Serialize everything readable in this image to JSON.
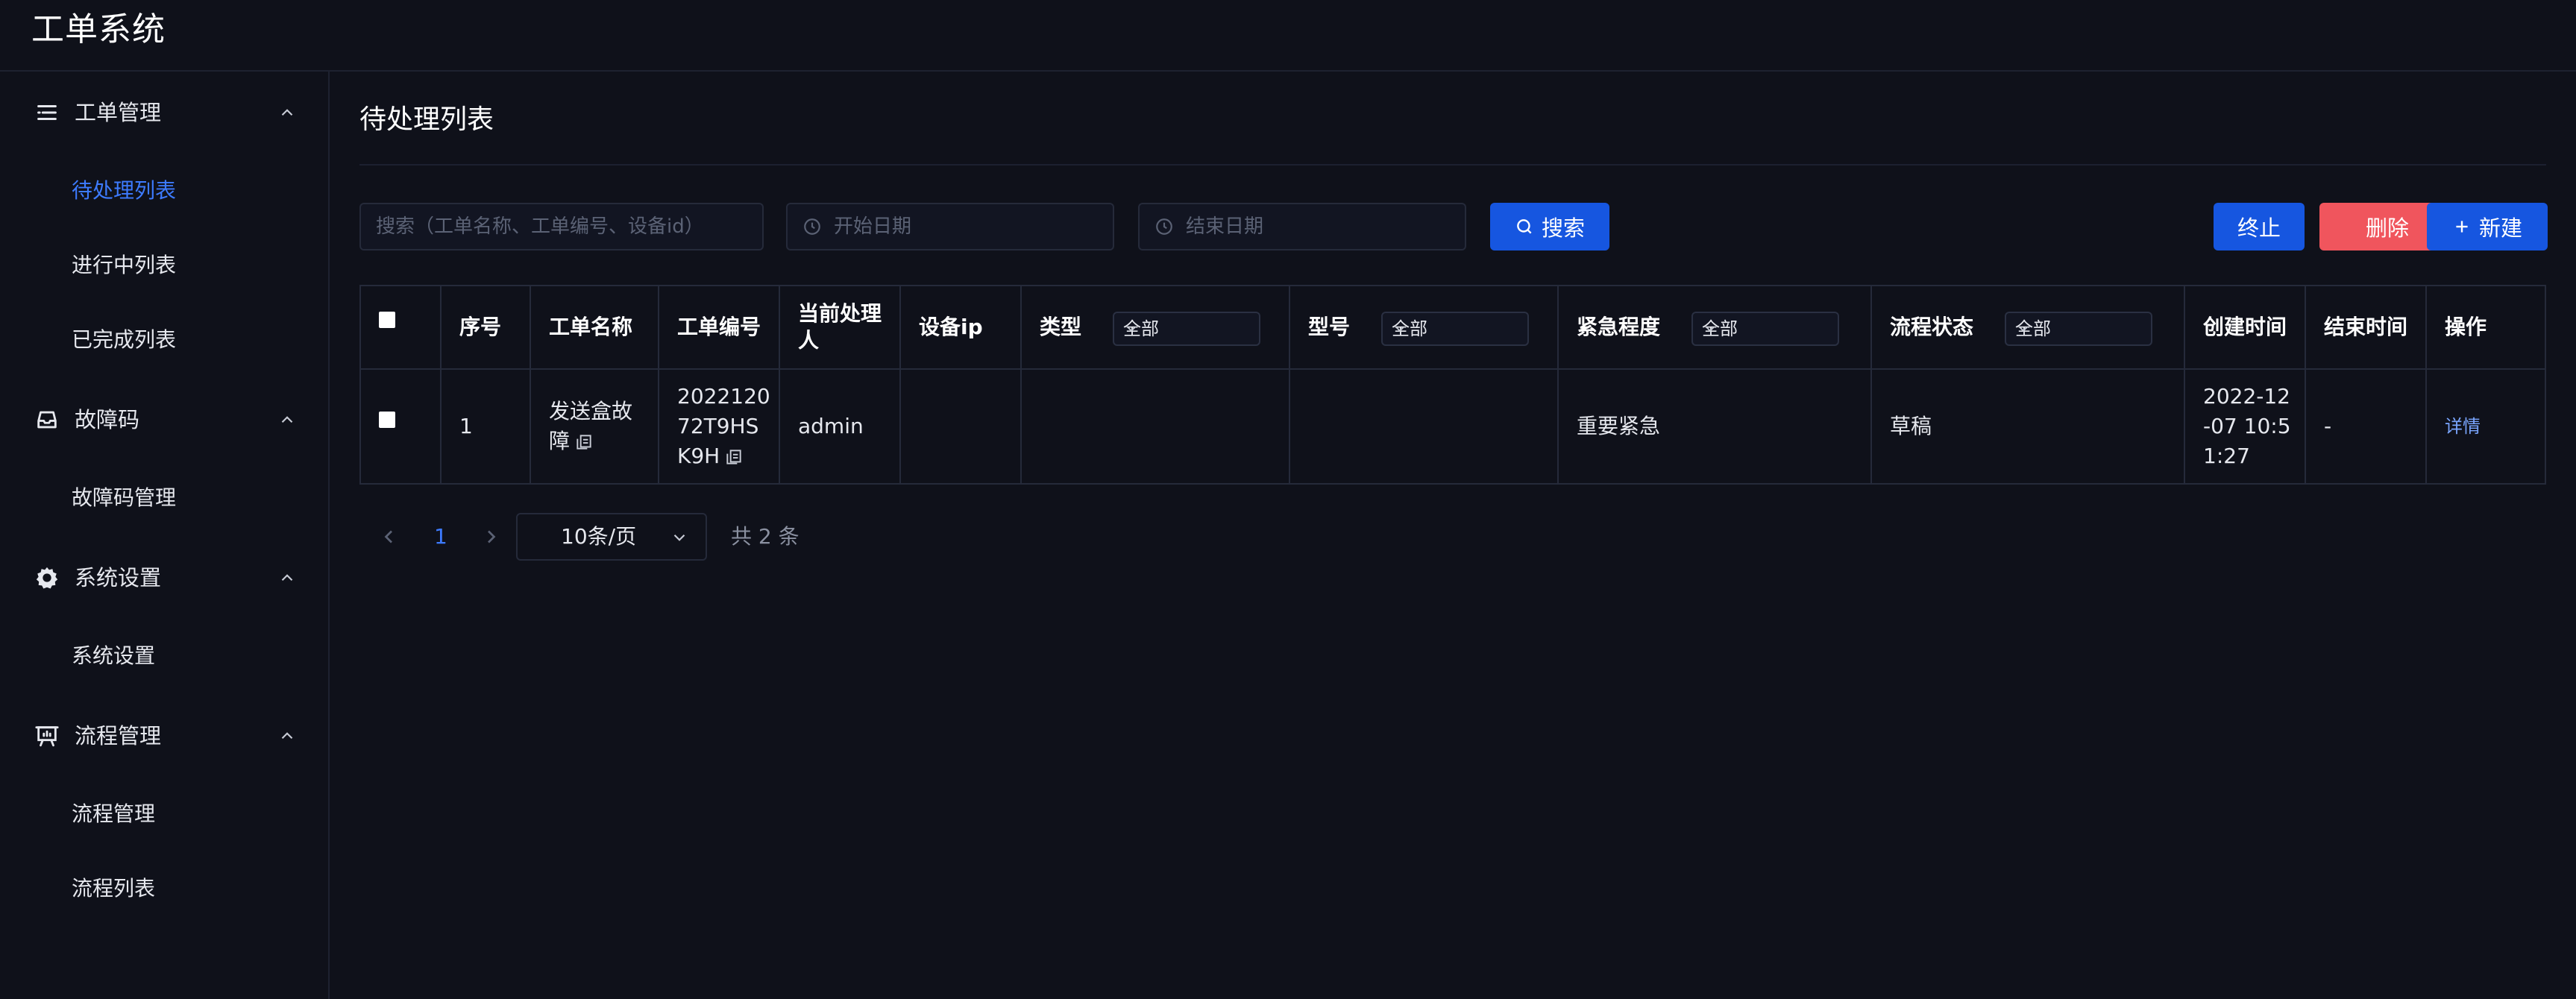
{
  "app": {
    "title": "工单系统"
  },
  "sidebar": {
    "groups": [
      {
        "label": "工单管理",
        "icon": "list-icon",
        "items": [
          {
            "label": "待处理列表",
            "active": true
          },
          {
            "label": "进行中列表"
          },
          {
            "label": "已完成列表"
          }
        ]
      },
      {
        "label": "故障码",
        "icon": "inbox-icon",
        "items": [
          {
            "label": "故障码管理"
          }
        ]
      },
      {
        "label": "系统设置",
        "icon": "gear-icon",
        "items": [
          {
            "label": "系统设置"
          }
        ]
      },
      {
        "label": "流程管理",
        "icon": "presentation-icon",
        "items": [
          {
            "label": "流程管理"
          },
          {
            "label": "流程列表"
          }
        ]
      }
    ]
  },
  "main": {
    "title": "待处理列表",
    "filters": {
      "search_placeholder": "搜索（工单名称、工单编号、设备id）",
      "start_date_placeholder": "开始日期",
      "end_date_placeholder": "结束日期",
      "search_button": "搜索"
    },
    "actions": {
      "terminate": "终止",
      "delete": "删除",
      "create": "新建"
    },
    "table": {
      "headers": {
        "index": "序号",
        "name": "工单名称",
        "number": "工单编号",
        "handler": "当前处理人",
        "device_ip": "设备ip",
        "type": "类型",
        "model": "型号",
        "urgency": "紧急程度",
        "flow_status": "流程状态",
        "created": "创建时间",
        "ended": "结束时间",
        "ops": "操作"
      },
      "filters": {
        "type": "全部",
        "model": "全部",
        "urgency": "全部",
        "flow_status": "全部"
      },
      "rows": [
        {
          "index": "1",
          "name": "发送盒故障",
          "number": "202212072T9HSK9H",
          "handler": "admin",
          "device_ip": "",
          "type": "",
          "model": "",
          "urgency": "重要紧急",
          "flow_status": "草稿",
          "created": "2022-12-07 10:51:27",
          "ended": "-",
          "action": "详情"
        }
      ]
    },
    "pagination": {
      "current_page": "1",
      "page_size": "10条/页",
      "total": "共 2 条"
    }
  },
  "colors": {
    "accent": "#1656e0",
    "danger": "#f0555d",
    "active_text": "#3d7bff",
    "background": "#0f111a"
  }
}
